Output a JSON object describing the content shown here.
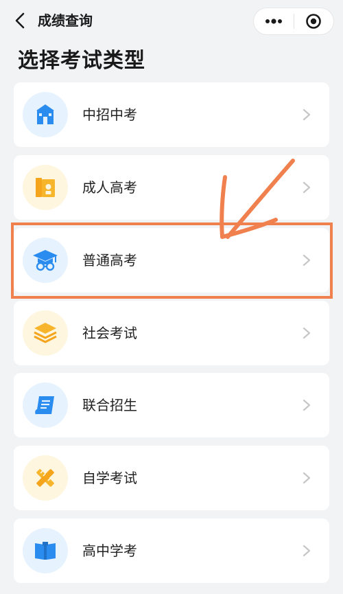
{
  "nav": {
    "title": "成绩查询"
  },
  "page": {
    "heading": "选择考试类型"
  },
  "exam_types": [
    {
      "label": "中招中考",
      "icon": "school-building-icon",
      "color": "blue"
    },
    {
      "label": "成人高考",
      "icon": "books-certificate-icon",
      "color": "yellow"
    },
    {
      "label": "普通高考",
      "icon": "graduation-cap-icon",
      "color": "blue"
    },
    {
      "label": "社会考试",
      "icon": "layers-stack-icon",
      "color": "yellow"
    },
    {
      "label": "联合招生",
      "icon": "scroll-document-icon",
      "color": "blue"
    },
    {
      "label": "自学考试",
      "icon": "pencil-ruler-icon",
      "color": "yellow"
    },
    {
      "label": "高中学考",
      "icon": "open-book-icon",
      "color": "blue"
    }
  ],
  "colors": {
    "icon_blue": "#2b8cf0",
    "icon_yellow": "#f7b52c",
    "annotation": "#f0814f"
  }
}
